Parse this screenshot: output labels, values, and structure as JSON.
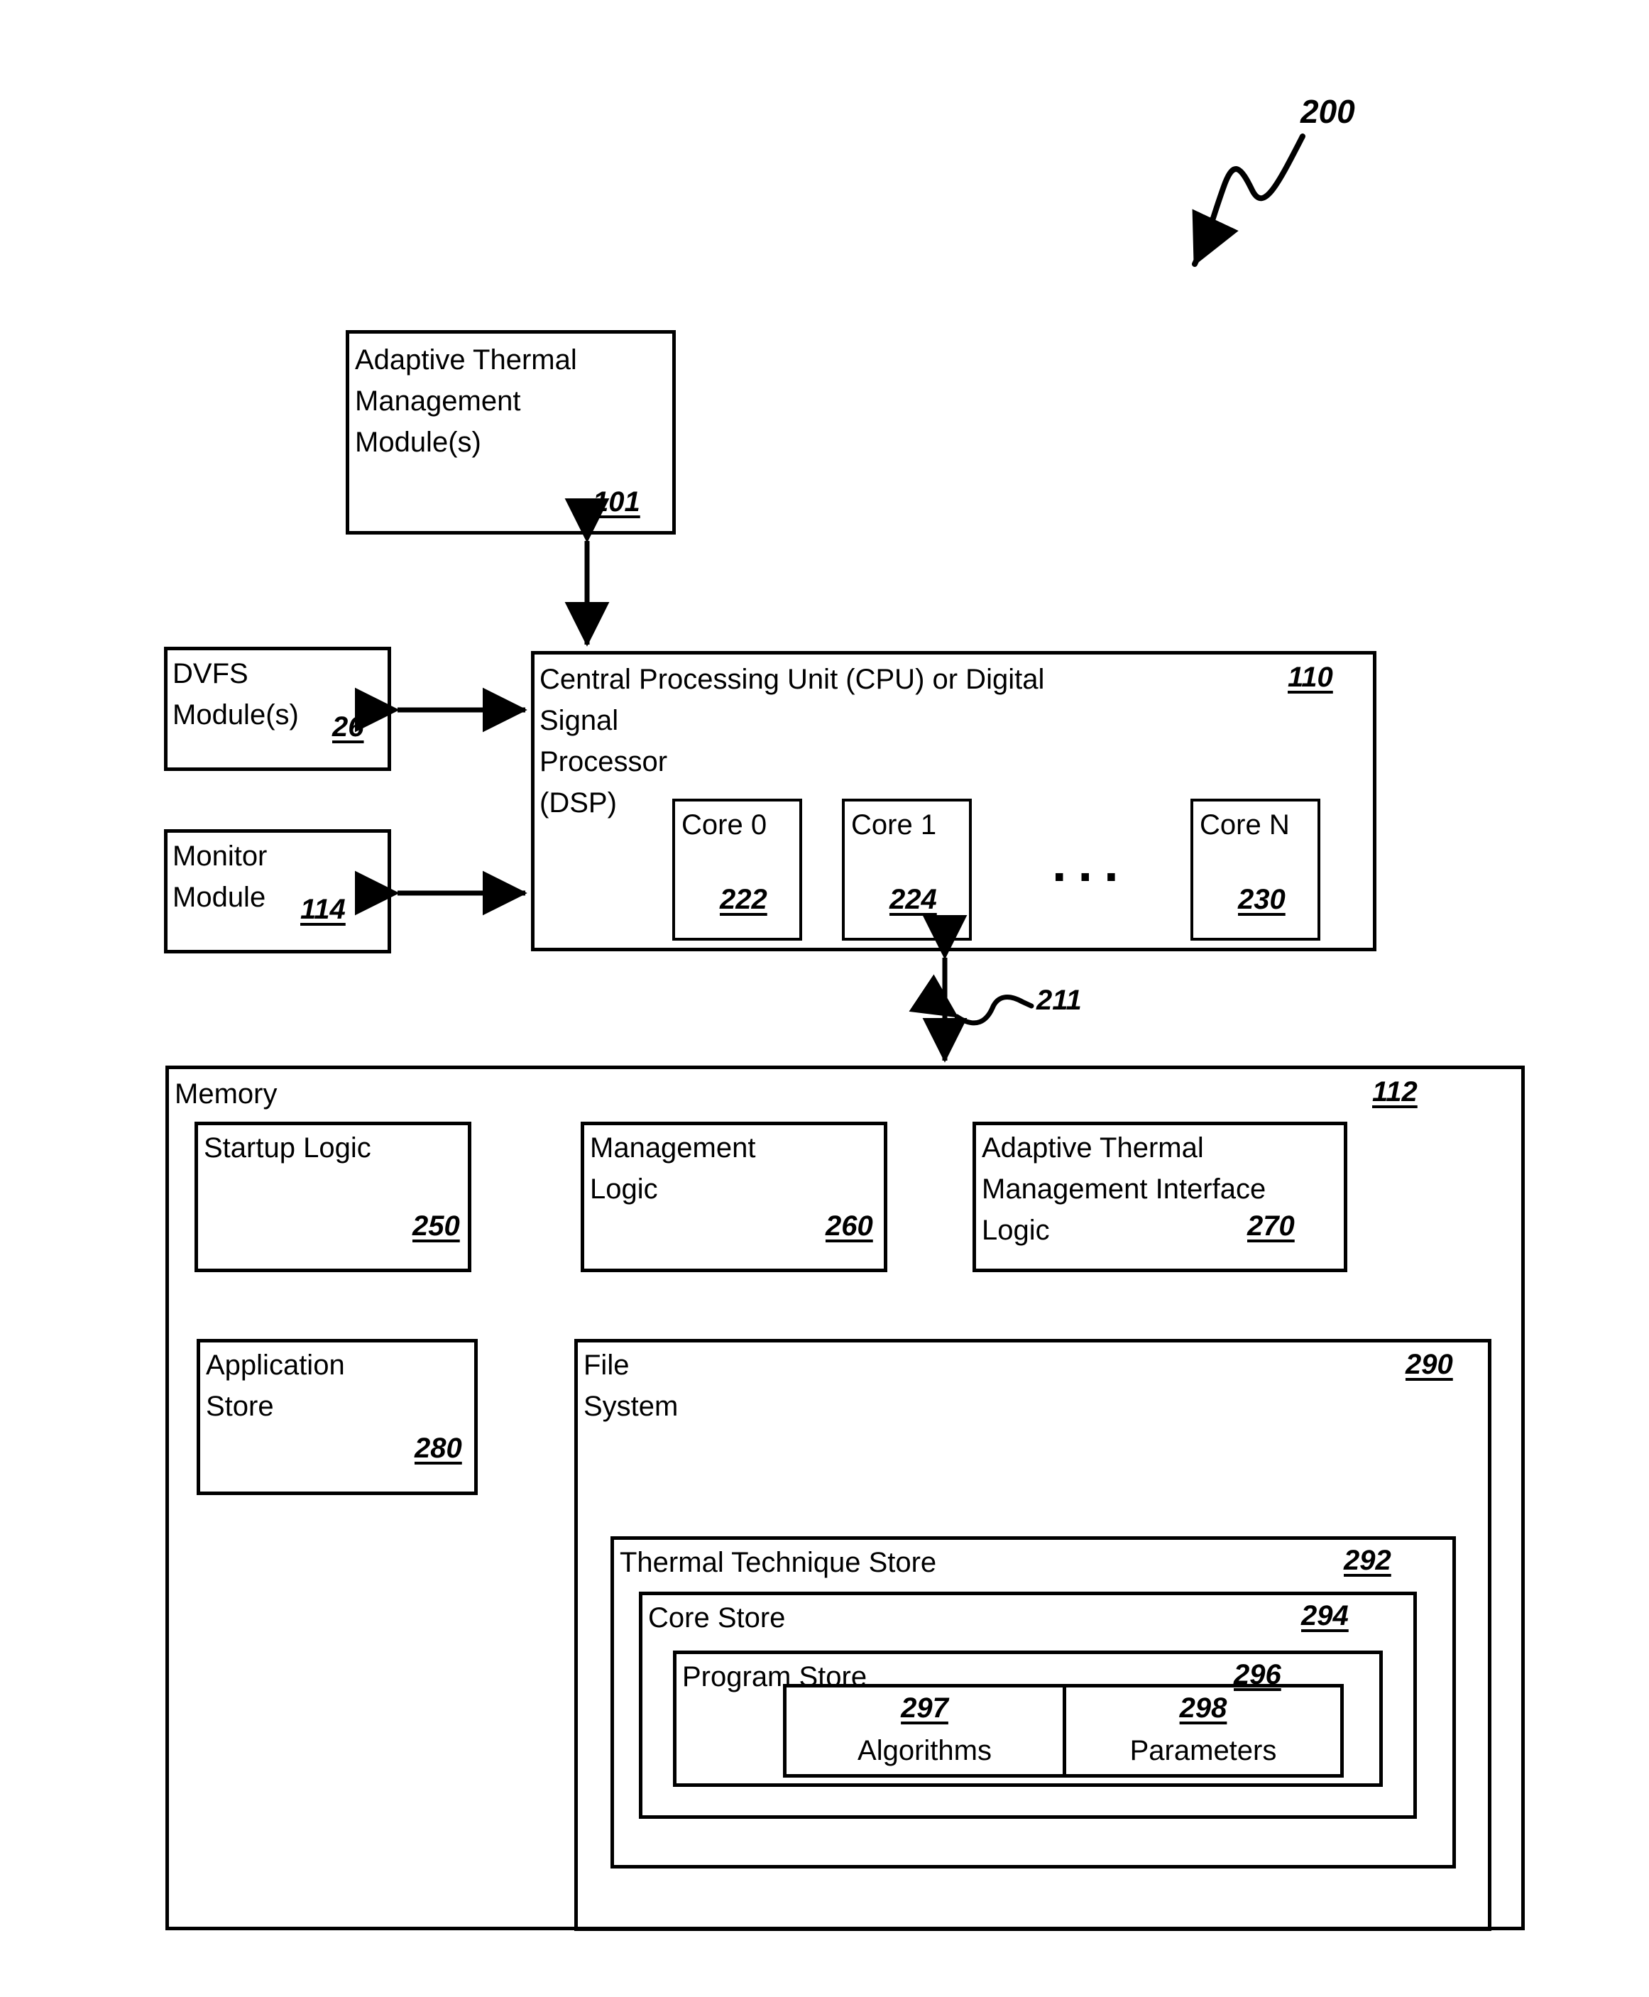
{
  "figure": {
    "number": "200",
    "type": "patent-block-diagram"
  },
  "blocks": {
    "adaptive_thermal_management_module": {
      "label": "Adaptive Thermal\nManagement\nModule(s)",
      "ref": "101"
    },
    "dvfs_module": {
      "label": "DVFS\nModule(s)",
      "ref": "26"
    },
    "monitor_module": {
      "label": "Monitor\nModule",
      "ref": "114"
    },
    "cpu": {
      "label": "Central Processing Unit (CPU) or Digital\nSignal\nProcessor\n(DSP)",
      "ref": "110",
      "ellipsis": "...",
      "cores": [
        {
          "label": "Core 0",
          "ref": "222"
        },
        {
          "label": "Core 1",
          "ref": "224"
        },
        {
          "label": "Core N",
          "ref": "230"
        }
      ]
    },
    "bus": {
      "ref": "211"
    },
    "memory": {
      "label": "Memory",
      "ref": "112",
      "startup_logic": {
        "label": "Startup Logic",
        "ref": "250"
      },
      "management_logic": {
        "label": "Management\nLogic",
        "ref": "260"
      },
      "adaptive_thermal_management_interface_logic": {
        "label": "Adaptive Thermal\nManagement Interface\nLogic",
        "ref": "270"
      },
      "application_store": {
        "label": "Application\nStore",
        "ref": "280"
      },
      "file_system": {
        "label": "File\nSystem",
        "ref": "290",
        "thermal_technique_store": {
          "label": "Thermal Technique Store",
          "ref": "292",
          "core_store": {
            "label": "Core Store",
            "ref": "294",
            "program_store": {
              "label": "Program Store",
              "ref": "296",
              "cells": [
                {
                  "ref": "297",
                  "label": "Algorithms"
                },
                {
                  "ref": "298",
                  "label": "Parameters"
                }
              ]
            }
          }
        }
      }
    }
  }
}
